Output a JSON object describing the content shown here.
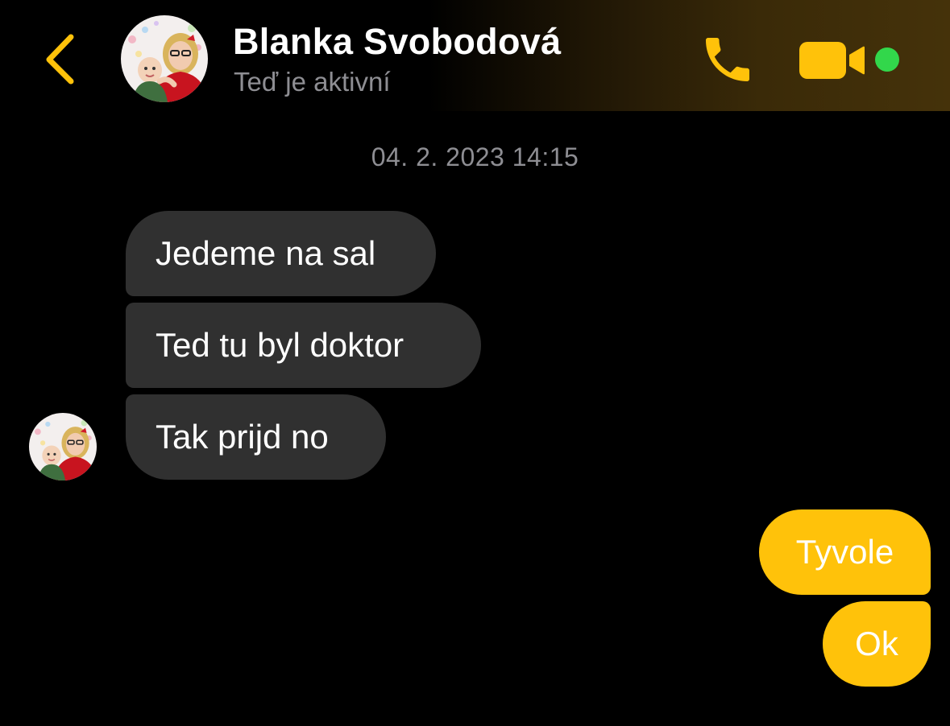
{
  "header": {
    "back_icon": "chevron-left-icon",
    "contact_name": "Blanka Svobodová",
    "status": "Teď je aktivní",
    "call_icon": "phone-icon",
    "video_icon": "video-camera-icon",
    "online": true
  },
  "conversation": {
    "timestamp": "04. 2. 2023 14:15",
    "incoming": [
      {
        "text": "Jedeme na sal"
      },
      {
        "text": "Ted tu byl doktor"
      },
      {
        "text": "Tak prijd no"
      }
    ],
    "outgoing": [
      {
        "text": "Tyvole"
      },
      {
        "text": "Ok"
      }
    ]
  },
  "colors": {
    "accent": "#ffc20a",
    "incoming_bubble": "#303030",
    "online": "#32d74b",
    "secondary_text": "#8e8e93"
  }
}
